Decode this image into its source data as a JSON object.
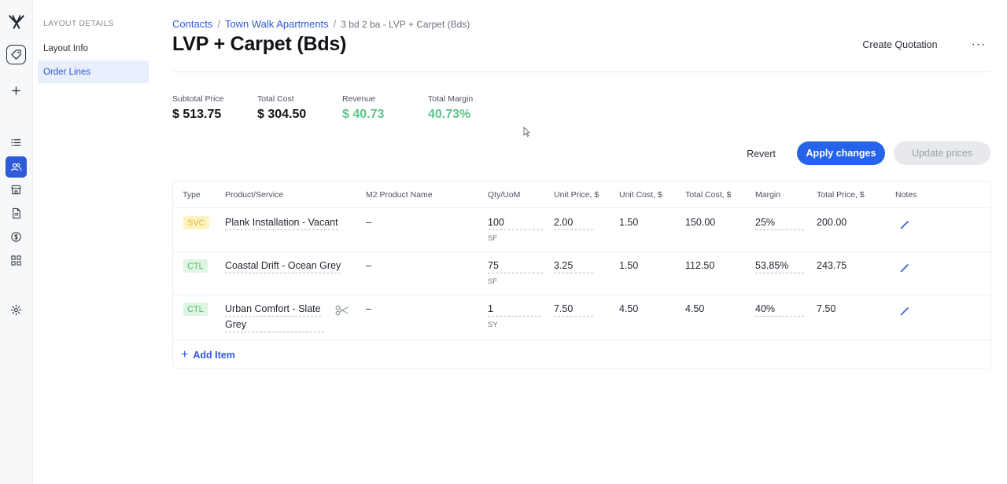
{
  "subnav": {
    "heading": "LAYOUT DETAILS",
    "items": [
      {
        "label": "Layout Info"
      },
      {
        "label": "Order Lines"
      }
    ]
  },
  "breadcrumb": {
    "contacts": "Contacts",
    "project": "Town Walk Apartments",
    "current": "3 bd 2 ba - LVP + Carpet (Bds)",
    "separator": "/"
  },
  "page": {
    "title": "LVP + Carpet (Bds)",
    "create_quotation": "Create Quotation",
    "more": "···"
  },
  "stats": {
    "subtotal": {
      "label": "Subtotal Price",
      "value": "$ 513.75"
    },
    "total_cost": {
      "label": "Total Cost",
      "value": "$ 304.50"
    },
    "revenue": {
      "label": "Revenue",
      "value": "$ 40.73"
    },
    "margin": {
      "label": "Total Margin",
      "value": "40.73%"
    }
  },
  "actions": {
    "revert": "Revert",
    "apply": "Apply changes",
    "update": "Update prices"
  },
  "table": {
    "headers": {
      "type": "Type",
      "product": "Product/Service",
      "m2": "M2 Product Name",
      "qty": "Qty/UoM",
      "unit_price": "Unit Price, $",
      "unit_cost": "Unit Cost, $",
      "total_cost": "Total Cost, $",
      "margin": "Margin",
      "total_price": "Total Price, $",
      "notes": "Notes"
    },
    "rows": [
      {
        "type": "SVC",
        "product": "Plank Installation - Vacant",
        "product2": "",
        "m2": "–",
        "qty": "100",
        "uom": "SF",
        "unit_price": "2.00",
        "unit_cost": "1.50",
        "total_cost": "150.00",
        "margin": "25%",
        "total_price": "200.00"
      },
      {
        "type": "CTL",
        "product": "Coastal Drift - Ocean Grey",
        "product2": "",
        "m2": "–",
        "qty": "75",
        "uom": "SF",
        "unit_price": "3.25",
        "unit_cost": "1.50",
        "total_cost": "112.50",
        "margin": "53.85%",
        "total_price": "243.75"
      },
      {
        "type": "CTL",
        "product": "Urban Comfort - Slate",
        "product2": "Grey",
        "m2": "–",
        "qty": "1",
        "uom": "SY",
        "unit_price": "7.50",
        "unit_cost": "4.50",
        "total_cost": "4.50",
        "margin": "40%",
        "total_price": "7.50"
      }
    ],
    "add_item": "Add Item"
  },
  "colors": {
    "accent": "#2563eb",
    "green": "#5cc58a",
    "svc_badge": "#e0b62a",
    "ctl_badge": "#4cb86b"
  }
}
